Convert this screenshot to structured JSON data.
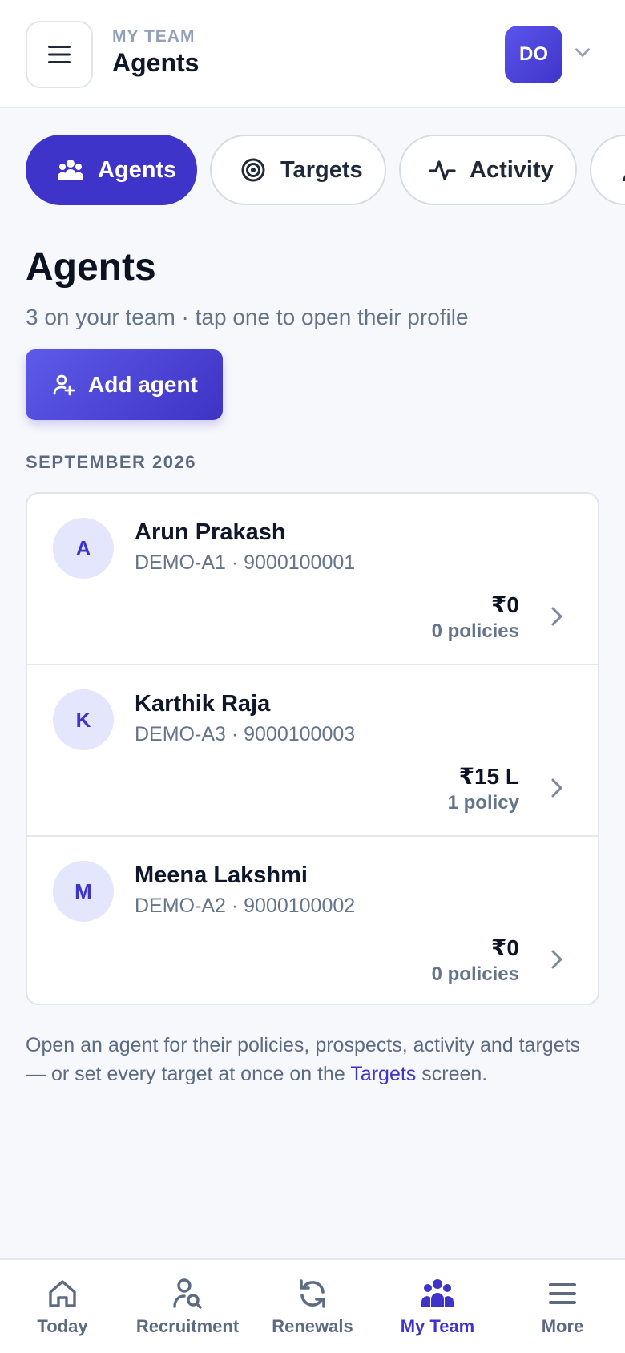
{
  "header": {
    "eyebrow": "MY TEAM",
    "title": "Agents",
    "avatar_initials": "DO"
  },
  "tabs": [
    {
      "label": "Agents",
      "icon": "people-group-icon",
      "active": true
    },
    {
      "label": "Targets",
      "icon": "target-icon",
      "active": false
    },
    {
      "label": "Activity",
      "icon": "activity-pulse-icon",
      "active": false
    },
    {
      "label": "",
      "icon": "person-icon",
      "active": false
    }
  ],
  "page": {
    "title": "Agents",
    "subtitle": "3 on your team · tap one to open their profile",
    "add_button": "Add agent",
    "month": "SEPTEMBER 2026"
  },
  "agents": [
    {
      "initial": "A",
      "name": "Arun Prakash",
      "meta": "DEMO-A1 · 9000100001",
      "amount": "₹0",
      "policies": "0 policies"
    },
    {
      "initial": "K",
      "name": "Karthik Raja",
      "meta": "DEMO-A3 · 9000100003",
      "amount": "₹15 L",
      "policies": "1 policy"
    },
    {
      "initial": "M",
      "name": "Meena Lakshmi",
      "meta": "DEMO-A2 · 9000100002",
      "amount": "₹0",
      "policies": "0 policies"
    }
  ],
  "footnote": {
    "before": "Open an agent for their policies, prospects, activity and targets — or set every target at once on the ",
    "link": "Targets",
    "after": " screen."
  },
  "bottom_nav": [
    {
      "label": "Today",
      "icon": "home-icon",
      "active": false
    },
    {
      "label": "Recruitment",
      "icon": "user-search-icon",
      "active": false
    },
    {
      "label": "Renewals",
      "icon": "refresh-icon",
      "active": false
    },
    {
      "label": "My Team",
      "icon": "team-icon",
      "active": true
    },
    {
      "label": "More",
      "icon": "menu-icon",
      "active": false
    }
  ],
  "colors": {
    "accent": "#3f34c9",
    "background": "#f7f8fc",
    "muted": "#64748b"
  }
}
